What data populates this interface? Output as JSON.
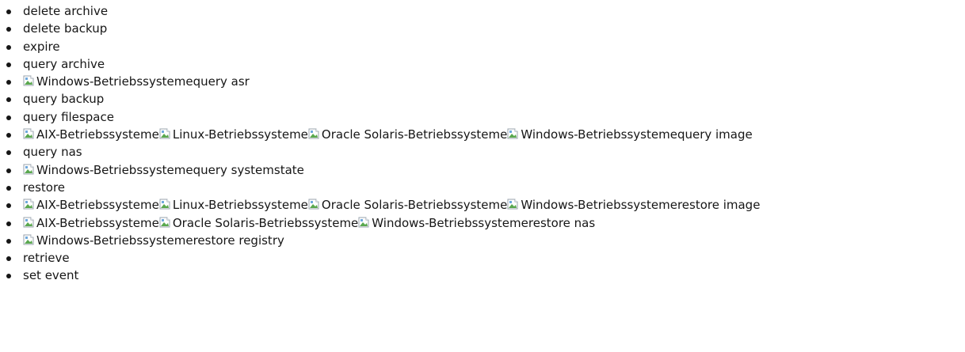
{
  "items": [
    {
      "platforms": [],
      "command": "delete archive"
    },
    {
      "platforms": [],
      "command": "delete backup"
    },
    {
      "platforms": [],
      "command": "expire"
    },
    {
      "platforms": [],
      "command": "query archive"
    },
    {
      "platforms": [
        "Windows-Betriebssysteme"
      ],
      "command": "query asr"
    },
    {
      "platforms": [],
      "command": "query backup"
    },
    {
      "platforms": [],
      "command": "query filespace"
    },
    {
      "platforms": [
        "AIX-Betriebssysteme",
        "Linux-Betriebssysteme",
        "Oracle Solaris-Betriebssysteme",
        "Windows-Betriebssysteme"
      ],
      "command": "query image"
    },
    {
      "platforms": [],
      "command": "query nas"
    },
    {
      "platforms": [
        "Windows-Betriebssysteme"
      ],
      "command": "query systemstate"
    },
    {
      "platforms": [],
      "command": "restore"
    },
    {
      "platforms": [
        "AIX-Betriebssysteme",
        "Linux-Betriebssysteme",
        "Oracle Solaris-Betriebssysteme",
        "Windows-Betriebssysteme"
      ],
      "command": "restore image"
    },
    {
      "platforms": [
        "AIX-Betriebssysteme",
        "Oracle Solaris-Betriebssysteme",
        "Windows-Betriebssysteme"
      ],
      "command": "restore nas"
    },
    {
      "platforms": [
        "Windows-Betriebssysteme"
      ],
      "command": "restore registry"
    },
    {
      "platforms": [],
      "command": "retrieve"
    },
    {
      "platforms": [],
      "command": "set event"
    }
  ],
  "icon": "broken-image-icon"
}
